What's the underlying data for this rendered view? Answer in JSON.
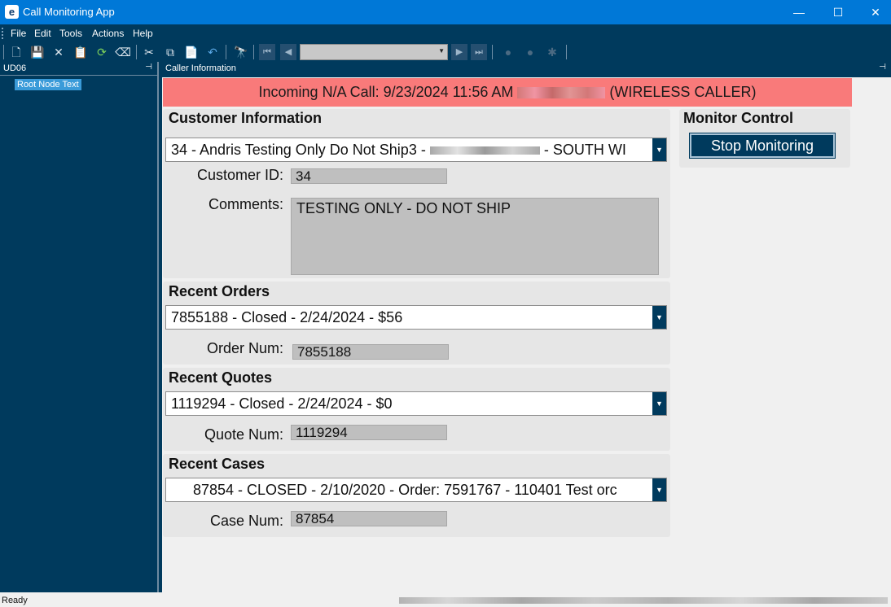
{
  "window": {
    "title": "Call Monitoring App",
    "app_icon": "e",
    "minimize": "—",
    "maximize": "☐",
    "close": "✕"
  },
  "menu": [
    "File",
    "Edit",
    "Tools",
    "Actions",
    "Help"
  ],
  "toolbar": {
    "icons": [
      "new-icon",
      "save-icon",
      "delete-icon",
      "clipboard-icon",
      "refresh-icon",
      "eraser-icon",
      "cut-icon",
      "copy-icon",
      "paste-icon",
      "undo-icon",
      "find-icon",
      "first-icon",
      "prev-icon",
      "next-icon",
      "last-icon"
    ]
  },
  "left_panel": {
    "title": "UD06",
    "pin": "⊣",
    "tree_root": "Root Node Text"
  },
  "right_panel": {
    "title": "Caller Information",
    "pin": "⊣"
  },
  "banner": {
    "prefix": "Incoming N/A Call: 9/23/2024 11:56 AM",
    "suffix": "(WIRELESS CALLER)",
    "color": "#f97a7a"
  },
  "customer": {
    "heading": "Customer Information",
    "combo_prefix": "34 - Andris Testing Only Do Not Ship3 -",
    "combo_suffix": "- SOUTH WI",
    "id_label": "Customer ID:",
    "id_value": "34",
    "comments_label": "Comments:",
    "comments_value": "TESTING ONLY - DO NOT SHIP"
  },
  "orders": {
    "heading": "Recent Orders",
    "combo": "7855188 - Closed - 2/24/2024 - $56",
    "num_label": "Order Num:",
    "num_value": "7855188"
  },
  "quotes": {
    "heading": "Recent Quotes",
    "combo": "1119294 - Closed - 2/24/2024 - $0",
    "num_label": "Quote Num:",
    "num_value": "1119294"
  },
  "cases": {
    "heading": "Recent Cases",
    "combo": "87854 - CLOSED - 2/10/2020 - Order: 7591767 -  110401 Test orc",
    "num_label": "Case Num:",
    "num_value": "87854"
  },
  "monitor": {
    "heading": "Monitor Control",
    "button": "Stop Monitoring"
  },
  "status": {
    "text": "Ready"
  },
  "colors": {
    "navy": "#003a5d",
    "title_blue": "#0078d7",
    "banner": "#f97a7a"
  }
}
